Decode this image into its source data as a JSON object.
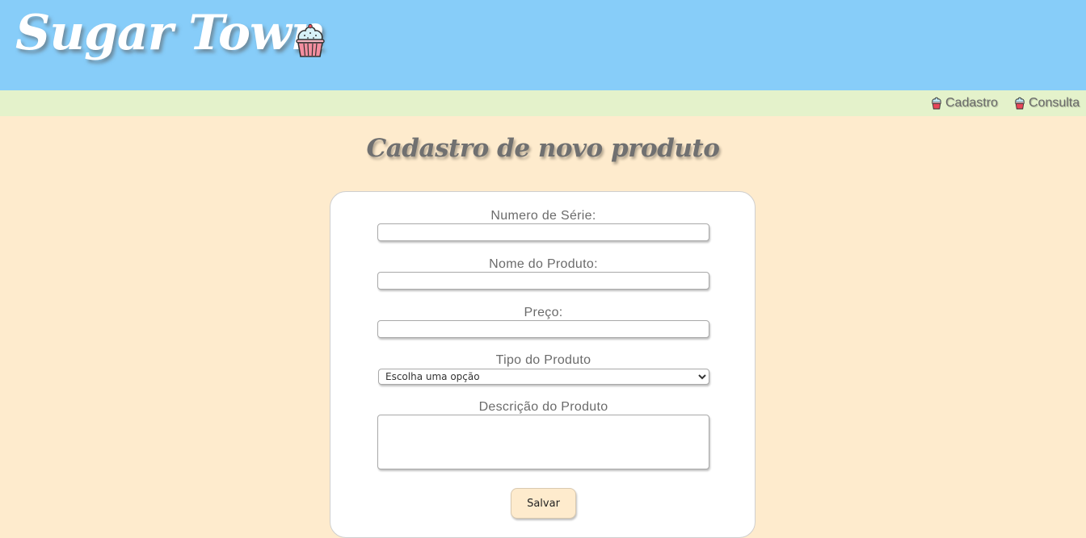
{
  "header": {
    "brand": "Sugar Town",
    "brand_icon": "cupcake-icon",
    "background_color": "#87cdf9"
  },
  "nav": {
    "background_color": "#e4f2cb",
    "links": [
      {
        "label": "Cadastro",
        "icon": "cupcake-icon"
      },
      {
        "label": "Consulta",
        "icon": "cupcake-icon"
      }
    ]
  },
  "main": {
    "title": "Cadastro de novo produto",
    "background_color": "#feebcd"
  },
  "form": {
    "serial_label": "Numero de Série:",
    "serial_value": "",
    "name_label": "Nome do Produto:",
    "name_value": "",
    "price_label": "Preço:",
    "price_value": "",
    "type_label": "Tipo do Produto",
    "type_selected": "Escolha uma opção",
    "description_label": "Descrição do Produto",
    "description_value": "",
    "save_label": "Salvar"
  }
}
